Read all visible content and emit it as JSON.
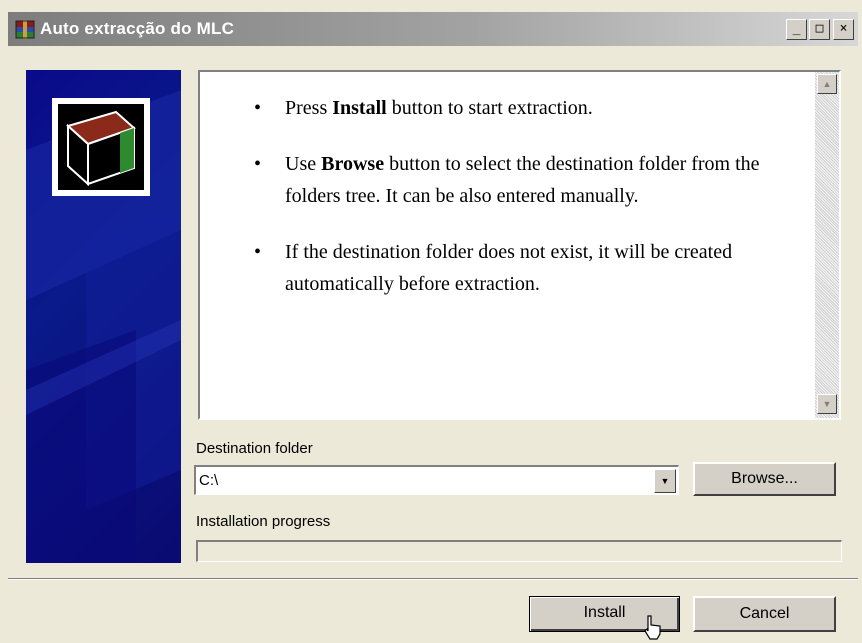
{
  "window": {
    "title": "Auto extracção do MLC",
    "controls": {
      "minimize": "_",
      "maximize": "□",
      "close": "×"
    }
  },
  "info": {
    "bullets": [
      {
        "prefix": "Press ",
        "bold": "Install",
        "suffix": " button to start extraction."
      },
      {
        "prefix": "Use ",
        "bold": "Browse",
        "suffix": " button to select the destination folder from the folders tree. It can be also entered manually."
      },
      {
        "prefix": "",
        "bold": "",
        "suffix": "If the destination folder does not exist, it will be created automatically before extraction."
      }
    ]
  },
  "destination": {
    "label": "Destination folder",
    "value": "C:\\",
    "browse_label": "Browse..."
  },
  "progress": {
    "label": "Installation progress",
    "value": 0
  },
  "footer": {
    "install_label": "Install",
    "cancel_label": "Cancel"
  }
}
